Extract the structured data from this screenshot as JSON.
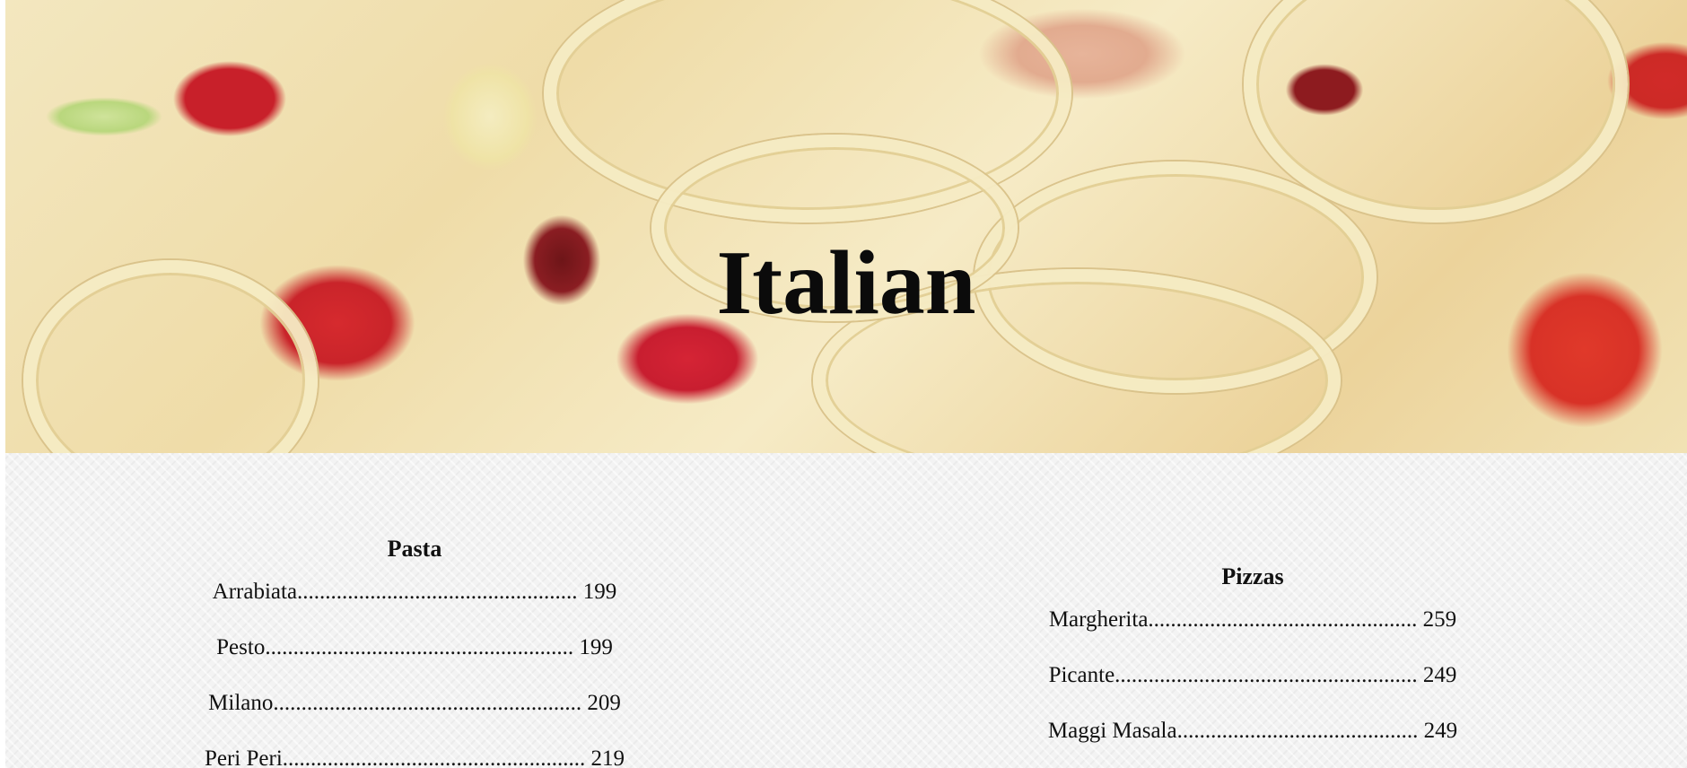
{
  "hero": {
    "title": "Italian"
  },
  "menu": {
    "pasta": {
      "heading": "Pasta",
      "items": [
        {
          "label": "Arrabiata.................................................. 199"
        },
        {
          "label": "Pesto....................................................... 199"
        },
        {
          "label": "Milano....................................................... 209"
        },
        {
          "label": "Peri Peri...................................................... 219"
        }
      ]
    },
    "pizza": {
      "heading": "Pizzas",
      "items": [
        {
          "label": "Margherita................................................ 259"
        },
        {
          "label": "Picante...................................................... 249"
        },
        {
          "label": "Maggi Masala........................................... 249"
        }
      ]
    }
  }
}
